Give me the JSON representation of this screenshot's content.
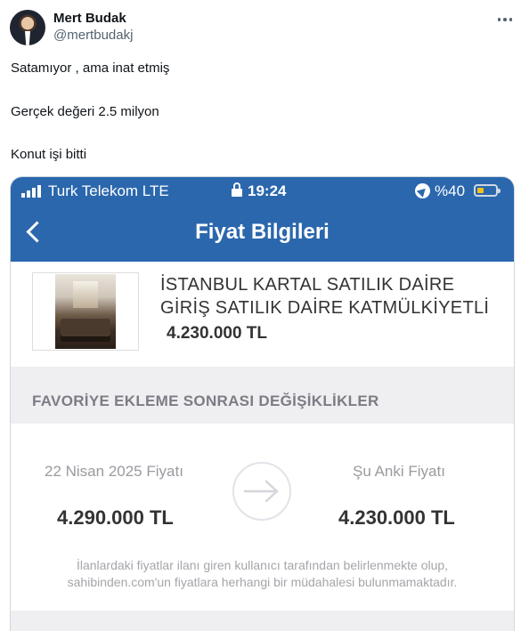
{
  "tweet": {
    "display_name": "Mert Budak",
    "handle": "@mertbudakj",
    "text_lines": [
      "Satamıyor , ama inat etmiş",
      "Gerçek değeri 2.5 milyon",
      "Konut işi bitti"
    ]
  },
  "phone": {
    "status_bar": {
      "carrier": "Turk Telekom  LTE",
      "time": "19:24",
      "battery": "%40"
    },
    "nav": {
      "title": "Fiyat Bilgileri"
    },
    "listing": {
      "title_line1": "İSTANBUL KARTAL SATILIK DAİRE",
      "title_line2": "GİRİŞ SATILIK DAİRE KATMÜLKİYETLİ",
      "price": "4.230.000 TL"
    },
    "section_title": "FAVORİYE EKLEME SONRASI DEĞİŞİKLİKLER",
    "comparison": {
      "old_label": "22 Nisan 2025 Fiyatı",
      "old_value": "4.290.000 TL",
      "new_label": "Şu Anki Fiyatı",
      "new_value": "4.230.000 TL"
    },
    "disclaimer": "İlanlardaki fiyatlar ilanı giren kullanıcı tarafından belirlenmekte olup, sahibinden.com'un fiyatlara herhangi bir müdahalesi bulunmamaktadır."
  },
  "colors": {
    "nav_blue": "#2b67ad",
    "battery_yellow": "#f3c11a",
    "muted_gray": "#9a9aa0"
  },
  "icons": [
    "avatar",
    "more-icon",
    "signal-icon",
    "lock-icon",
    "location-icon",
    "battery-icon",
    "back-chevron-icon",
    "arrow-right-icon"
  ]
}
